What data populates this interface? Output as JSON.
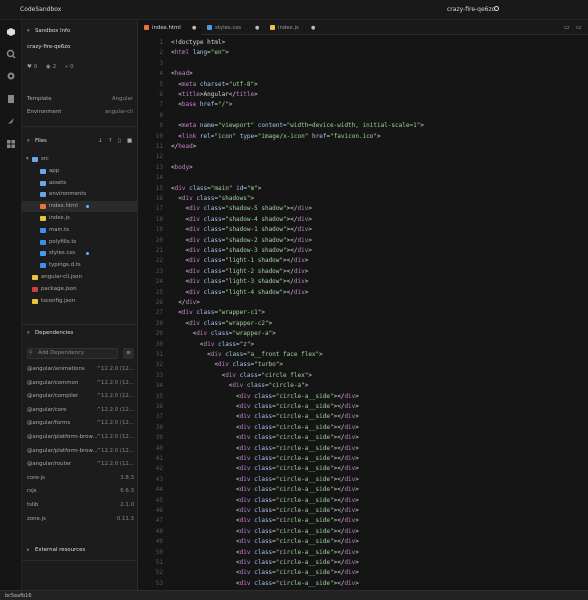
{
  "app": {
    "name": "CodeSandbox",
    "project": "crazy-fire-qe6zo"
  },
  "sidebar": {
    "info_header": "Sandbox Info",
    "sandbox_name": "crazy-fire-qe6zo",
    "stats": [
      "0",
      "2",
      "0"
    ],
    "template_label": "Template",
    "template_value": "Angular",
    "env_label": "Environment",
    "env_value": "angular-cli",
    "files_header": "Files",
    "files": [
      {
        "name": "src",
        "type": "folder"
      },
      {
        "name": "app",
        "type": "folder"
      },
      {
        "name": "assets",
        "type": "folder"
      },
      {
        "name": "environments",
        "type": "folder"
      },
      {
        "name": "index.html",
        "type": "html",
        "active": true,
        "modified": true
      },
      {
        "name": "index.js",
        "type": "js"
      },
      {
        "name": "main.ts",
        "type": "ts"
      },
      {
        "name": "polyfills.ts",
        "type": "ts"
      },
      {
        "name": "styles.css",
        "type": "css",
        "modified": true
      },
      {
        "name": "typings.d.ts",
        "type": "ts"
      },
      {
        "name": "angular-cli.json",
        "type": "json"
      },
      {
        "name": "package.json",
        "type": "pkg"
      },
      {
        "name": "tsconfig.json",
        "type": "json"
      }
    ],
    "deps_header": "Dependencies",
    "add_dep_placeholder": "Add Dependency",
    "deps": [
      {
        "name": "@angular/animations",
        "version": "^12.2.0 (12..."
      },
      {
        "name": "@angular/common",
        "version": "^12.2.0 (12..."
      },
      {
        "name": "@angular/compiler",
        "version": "^12.2.0 (12..."
      },
      {
        "name": "@angular/core",
        "version": "^12.2.0 (12..."
      },
      {
        "name": "@angular/forms",
        "version": "^12.2.0 (12..."
      },
      {
        "name": "@angular/platform-brow...",
        "version": "^12.2.0 (12..."
      },
      {
        "name": "@angular/platform-brow...",
        "version": "^12.2.0 (12..."
      },
      {
        "name": "@angular/router",
        "version": "^12.2.0 (12..."
      },
      {
        "name": "core-js",
        "version": "3.8.3"
      },
      {
        "name": "rxjs",
        "version": "6.6.3"
      },
      {
        "name": "tslib",
        "version": "2.1.0"
      },
      {
        "name": "zone.js",
        "version": "0.11.3"
      }
    ],
    "ext_header": "External resources"
  },
  "tabs": [
    {
      "label": "index.html",
      "color": "#e8733c",
      "active": true
    },
    {
      "label": "styles.css",
      "color": "#4a9be8",
      "active": false
    },
    {
      "label": "index.js",
      "color": "#e8c43c",
      "active": false
    }
  ],
  "editor": {
    "start_line": 1,
    "lines": [
      "<!doctype html>",
      "<html lang=\"en\">",
      "",
      "<head>",
      "  <meta charset=\"utf-8\">",
      "  <title>Angular</title>",
      "  <base href=\"/\">",
      "",
      "  <meta name=\"viewport\" content=\"width=device-width, initial-scale=1\">",
      "  <link rel=\"icon\" type=\"image/x-icon\" href=\"favicon.ico\">",
      "</head>",
      "",
      "<body>",
      "",
      "<div class=\"main\" id=\"m\">",
      "  <div class=\"shadows\">",
      "    <div class=\"shadow-5 shadow\"></div>",
      "    <div class=\"shadow-4 shadow\"></div>",
      "    <div class=\"shadow-1 shadow\"></div>",
      "    <div class=\"shadow-2 shadow\"></div>",
      "    <div class=\"shadow-3 shadow\"></div>",
      "    <div class=\"light-1 shadow\"></div>",
      "    <div class=\"light-2 shadow\"></div>",
      "    <div class=\"light-3 shadow\"></div>",
      "    <div class=\"light-4 shadow\"></div>",
      "  </div>",
      "  <div class=\"wrapper-c1\">",
      "    <div class=\"wrapper-c2\">",
      "      <div class=\"wrapper-a\">",
      "        <div class=\"z\">",
      "          <div class=\"a__front face flex\">",
      "            <div class=\"turbo\">",
      "              <div class=\"circle flex\">",
      "                <div class=\"circle-a\">",
      "                  <div class=\"circle-a__side\"></div>",
      "                  <div class=\"circle-a__side\"></div>",
      "                  <div class=\"circle-a__side\"></div>",
      "                  <div class=\"circle-a__side\"></div>",
      "                  <div class=\"circle-a__side\"></div>",
      "                  <div class=\"circle-a__side\"></div>",
      "                  <div class=\"circle-a__side\"></div>",
      "                  <div class=\"circle-a__side\"></div>",
      "                  <div class=\"circle-a__side\"></div>",
      "                  <div class=\"circle-a__side\"></div>",
      "                  <div class=\"circle-a__side\"></div>",
      "                  <div class=\"circle-a__side\"></div>",
      "                  <div class=\"circle-a__side\"></div>",
      "                  <div class=\"circle-a__side\"></div>",
      "                  <div class=\"circle-a__side\"></div>",
      "                  <div class=\"circle-a__side\"></div>",
      "                  <div class=\"circle-a__side\"></div>",
      "                  <div class=\"circle-a__side\"></div>",
      "                  <div class=\"circle-a__side\"></div>"
    ]
  },
  "status": {
    "text": "bc5eafb16"
  }
}
